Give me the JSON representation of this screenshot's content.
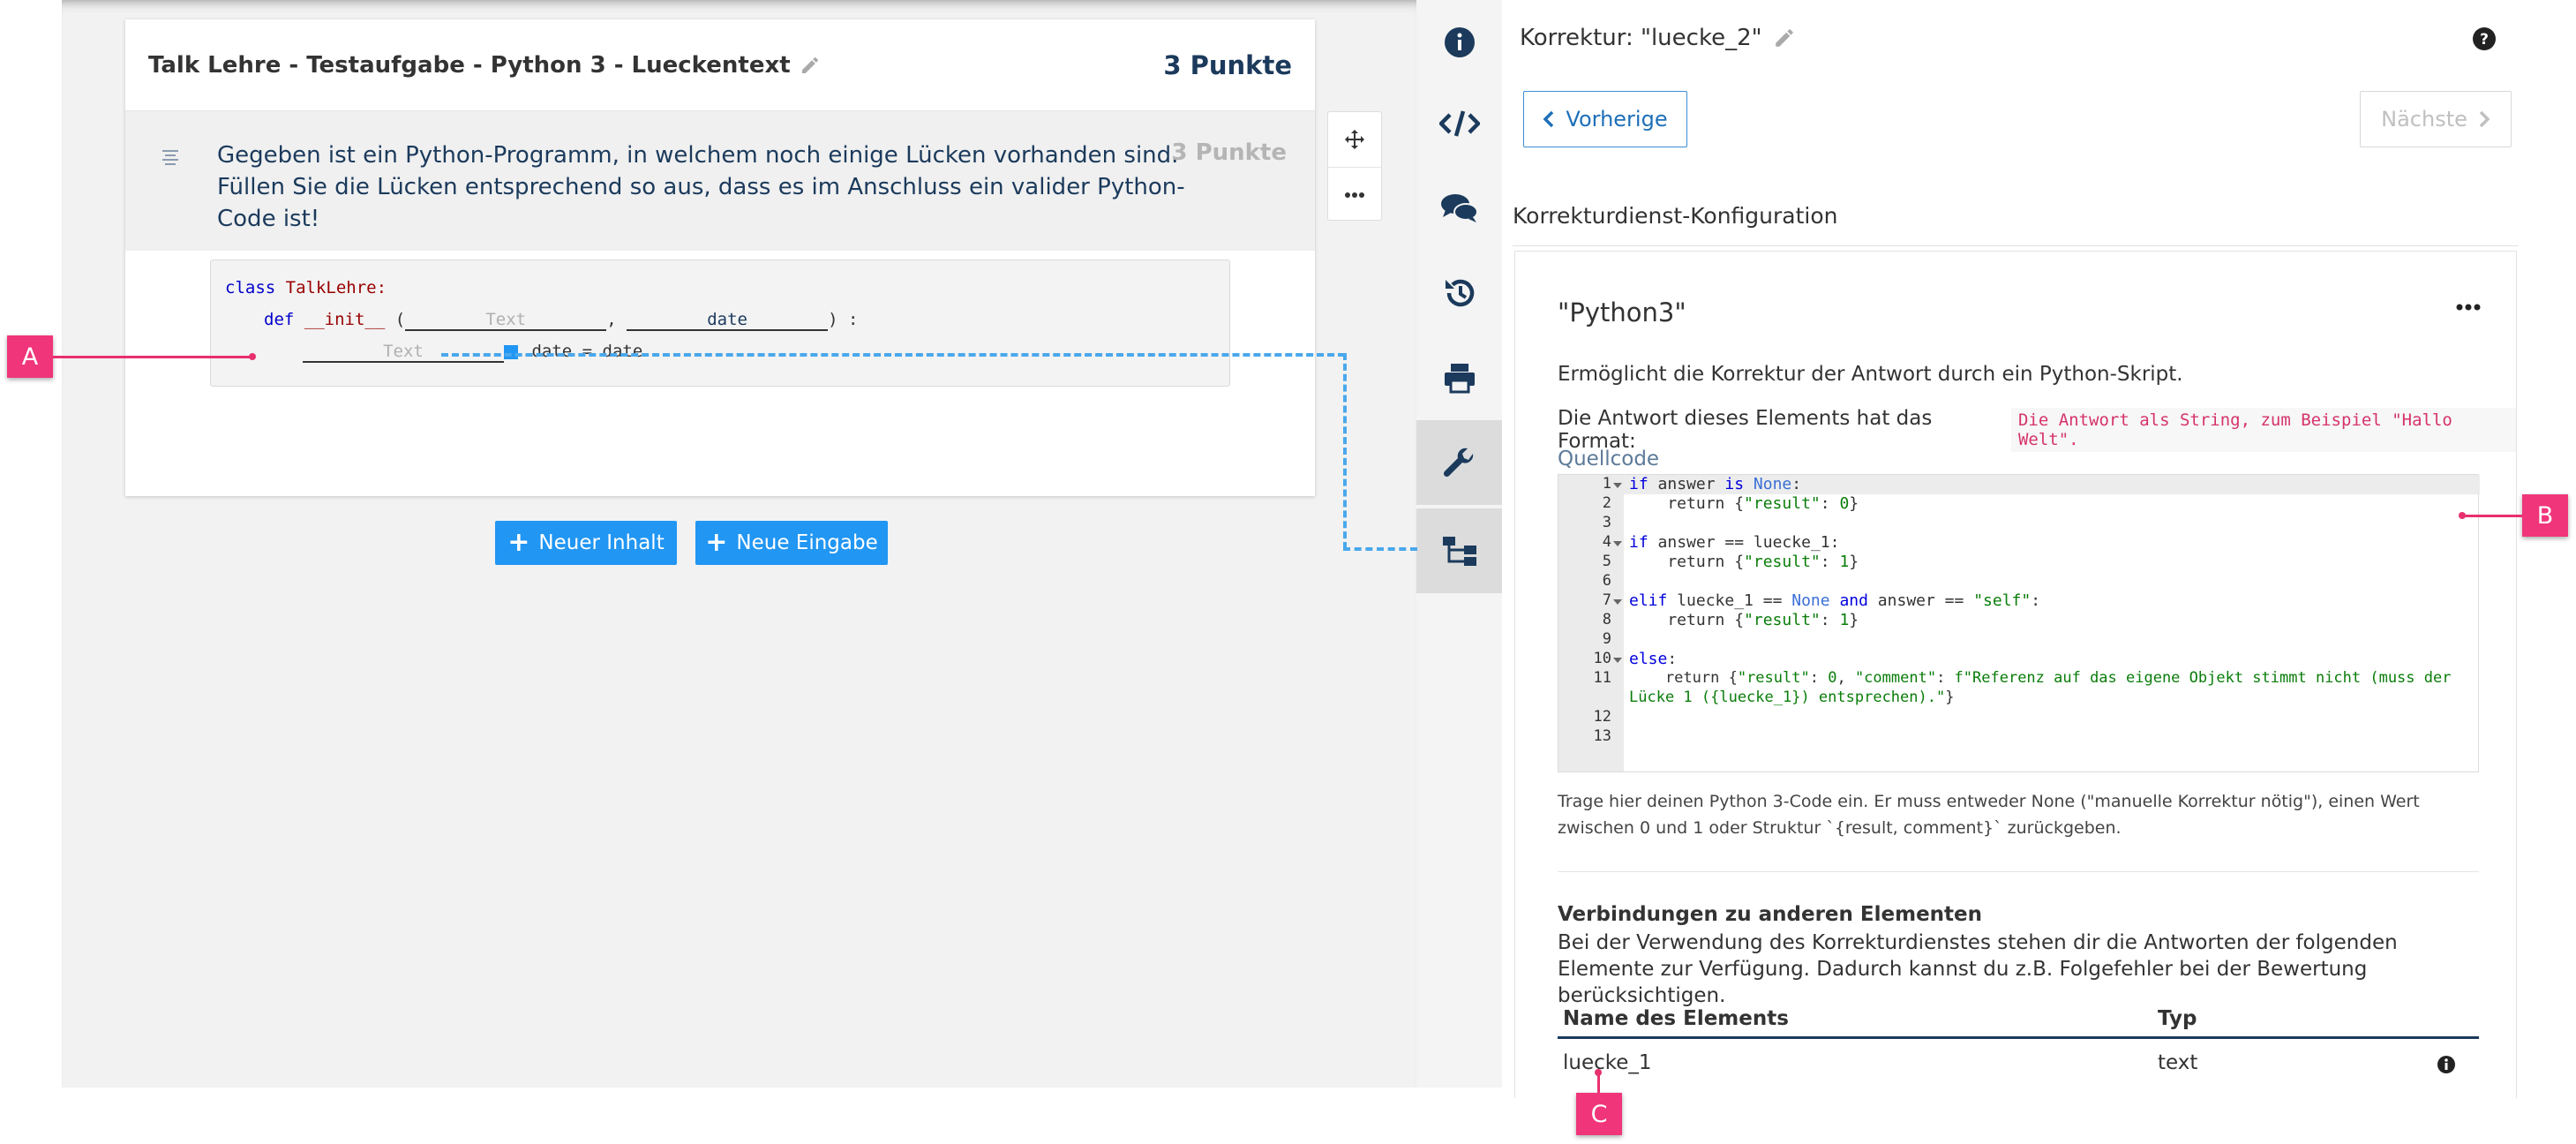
{
  "task": {
    "title": "Talk Lehre - Testaufgabe - Python 3 - Lueckentext",
    "points": "3 Punkte",
    "description": "Gegeben ist ein Python-Programm, in welchem noch einige Lücken vorhanden sind. Füllen Sie die Lücken entsprechend so aus, dass es im Anschluss ein valider Python-Code ist!",
    "description_points": "3 Punkte",
    "code": {
      "line1_kw": "class",
      "line1_name": "TalkLehre:",
      "line2_kw": "def",
      "line2_name": "__init__",
      "line2_open": "(",
      "gap1_placeholder": "Text",
      "comma": ",",
      "gap2_value": "date",
      "line2_close": ") :",
      "gap3_placeholder": "Text",
      "line3_rest": ".date = date"
    }
  },
  "buttons": {
    "new_content": "Neuer Inhalt",
    "new_input": "Neue Eingabe"
  },
  "panel": {
    "title": "Korrektur: \"luecke_2\"",
    "prev": "Vorherige",
    "next": "Nächste",
    "section": "Korrekturdienst-Konfiguration",
    "config_name": "\"Python3\"",
    "desc1": "Ermöglicht die Korrektur der Antwort durch ein Python-Skript.",
    "desc2_label": "Die Antwort dieses Elements hat das Format:",
    "desc2_format": "Die Antwort als String, zum Beispiel \"Hallo Welt\".",
    "source_label": "Quellcode",
    "line_numbers": [
      "1",
      "2",
      "3",
      "4",
      "5",
      "6",
      "7",
      "8",
      "9",
      "10",
      "11",
      "",
      "12",
      "13"
    ],
    "code_lines": {
      "l1a": "if",
      "l1b": " answer ",
      "l1c": "is",
      "l1d": "None",
      "l1e": ":",
      "l2a": "    return {",
      "l2b": "\"result\"",
      "l2c": ": ",
      "l2d": "0",
      "l2e": "}",
      "l4a": "if",
      "l4b": " answer == luecke_1:",
      "l5a": "    return {",
      "l5b": "\"result\"",
      "l5c": ": ",
      "l5d": "1",
      "l5e": "}",
      "l7a": "elif",
      "l7b": " luecke_1 == ",
      "l7c": "None",
      "l7d": " and",
      "l7e": " answer == ",
      "l7f": "\"self\"",
      "l7g": ":",
      "l8a": "    return {",
      "l8b": "\"result\"",
      "l8c": ": ",
      "l8d": "1",
      "l8e": "}",
      "l10a": "else",
      "l10b": ":",
      "l11a": "    return {",
      "l11b": "\"result\"",
      "l11c": ": ",
      "l11d": "0",
      "l11e": ", ",
      "l11f": "\"comment\"",
      "l11g": ": ",
      "l11h": "f\"Referenz auf das eigene Objekt stimmt nicht (muss der",
      "l11i": "Lücke 1 ({luecke_1}) entsprechen).\"",
      "l11j": "}"
    },
    "help_text": "Trage hier deinen Python 3-Code ein. Er muss entweder None (\"manuelle Korrektur nötig\"), einen Wert zwischen 0 und 1 oder Struktur `{result, comment}` zurückgeben.",
    "connections_title": "Verbindungen zu anderen Elementen",
    "connections_desc": "Bei der Verwendung des Korrekturdienstes stehen dir die Antworten der folgenden Elemente zur Verfügung. Dadurch kannst du z.B. Folgefehler bei der Bewertung berücksichtigen.",
    "table_headers": {
      "name": "Name des Elements",
      "type": "Typ"
    },
    "table_rows": [
      {
        "name": "luecke_1",
        "type": "text"
      }
    ]
  },
  "markers": {
    "a": "A",
    "b": "B",
    "c": "C"
  },
  "colors": {
    "accent": "#2196f3",
    "marker": "#f0357a",
    "navy": "#1b3a5c"
  }
}
